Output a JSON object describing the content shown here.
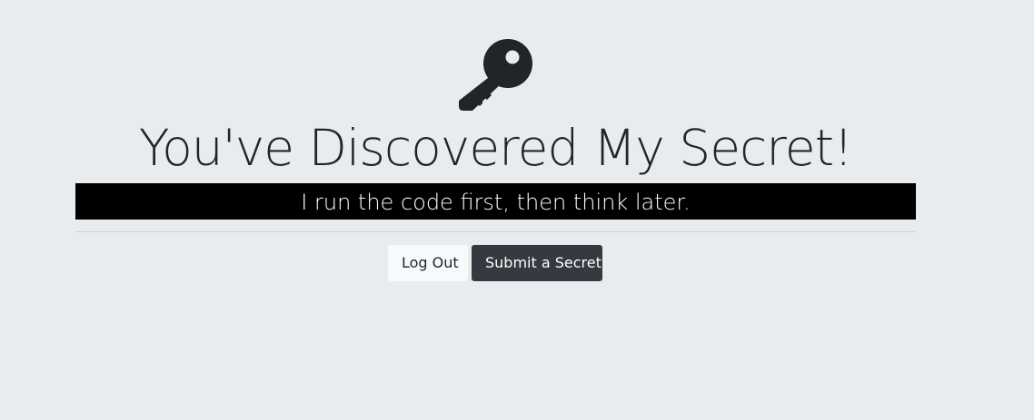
{
  "icon": "key-icon",
  "heading": "You've Discovered My Secret!",
  "secret": "I run the code first, then think later.",
  "buttons": {
    "logout_label": "Log Out",
    "submit_label": "Submit a Secret"
  },
  "colors": {
    "background": "#e9ecef",
    "secret_bar": "#000000",
    "secret_text": "#ffffff",
    "button_light": "#f8f9fa",
    "button_dark": "#343a40",
    "text_dark": "#212529"
  }
}
